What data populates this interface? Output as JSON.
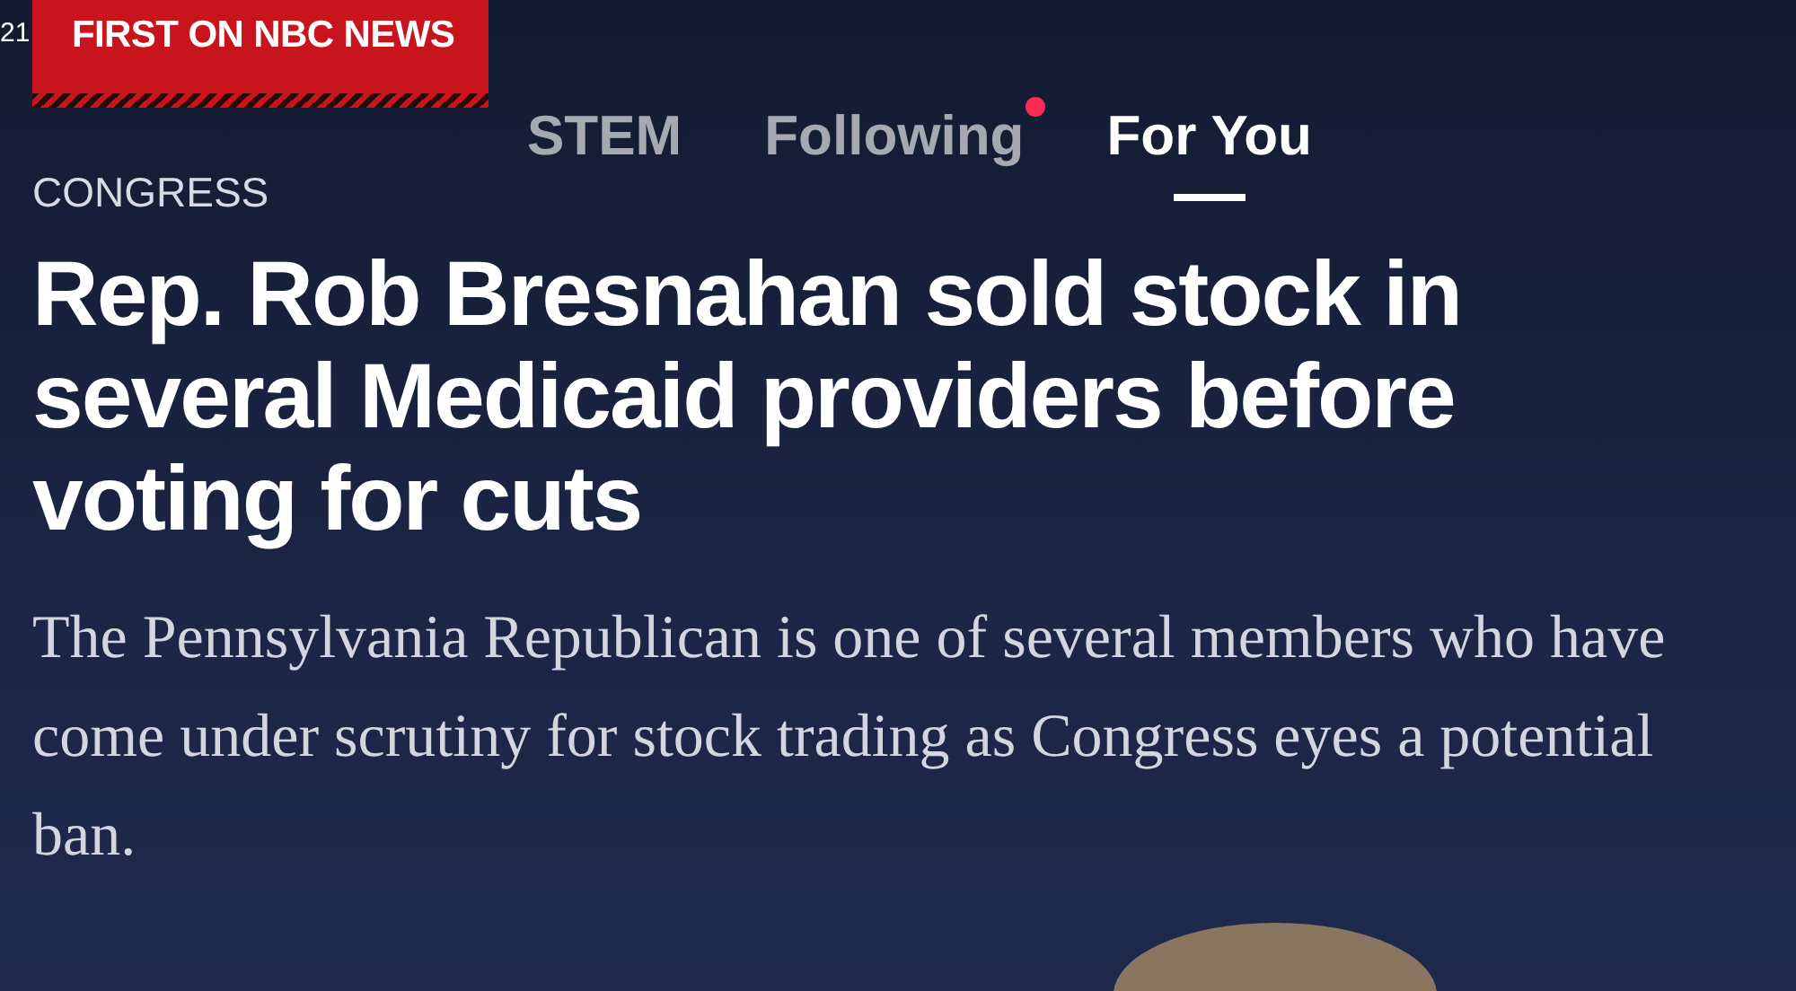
{
  "status_bar": {
    "time": "21"
  },
  "tabs": [
    {
      "label": "STEM",
      "selected": false,
      "badge": false
    },
    {
      "label": "Following",
      "selected": false,
      "badge": true
    },
    {
      "label": "For You",
      "selected": true,
      "badge": false
    }
  ],
  "article": {
    "banner": "FIRST ON NBC NEWS",
    "section": "CONGRESS",
    "headline": "Rep. Rob Bresnahan sold stock in several Medicaid providers before voting for cuts",
    "summary": "The Pennsylvania Republican is one of several members who have come under scrutiny for stock trading as Congress eyes a potential ban."
  }
}
